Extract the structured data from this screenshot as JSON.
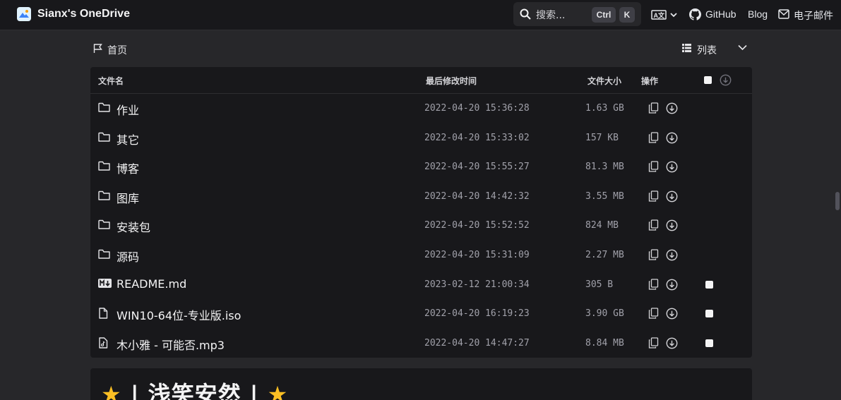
{
  "header": {
    "brand": "Sianx's OneDrive",
    "search_placeholder": "搜索...",
    "kbd_ctrl": "Ctrl",
    "kbd_k": "K",
    "github": "GitHub",
    "blog": "Blog",
    "email": "电子邮件"
  },
  "breadcrumb": {
    "home": "首页"
  },
  "view": {
    "label": "列表"
  },
  "table": {
    "columns": {
      "name": "文件名",
      "modified": "最后修改时间",
      "size": "文件大小",
      "actions": "操作"
    },
    "rows": [
      {
        "type": "folder",
        "name": "作业",
        "modified": "2022-04-20 15:36:28",
        "size": "1.63 GB"
      },
      {
        "type": "folder",
        "name": "其它",
        "modified": "2022-04-20 15:33:02",
        "size": "157 KB"
      },
      {
        "type": "folder",
        "name": "博客",
        "modified": "2022-04-20 15:55:27",
        "size": "81.3 MB"
      },
      {
        "type": "folder",
        "name": "图库",
        "modified": "2022-04-20 14:42:32",
        "size": "3.55 MB"
      },
      {
        "type": "folder",
        "name": "安装包",
        "modified": "2022-04-20 15:52:52",
        "size": "824 MB"
      },
      {
        "type": "folder",
        "name": "源码",
        "modified": "2022-04-20 15:31:09",
        "size": "2.27 MB"
      },
      {
        "type": "markdown",
        "name": "README.md",
        "modified": "2023-02-12 21:00:34",
        "size": "305 B"
      },
      {
        "type": "file",
        "name": "WIN10-64位-专业版.iso",
        "modified": "2022-04-20 16:19:23",
        "size": "3.90 GB"
      },
      {
        "type": "audio",
        "name": "木小雅 - 可能否.mp3",
        "modified": "2022-04-20 14:47:27",
        "size": "8.84 MB"
      }
    ]
  },
  "readme": {
    "star_left": "★",
    "title": "| 浅笑安然 |",
    "star_right": "★"
  },
  "colors": {
    "header_bg": "#18181b",
    "page_bg": "#27272a",
    "card_bg": "#18181b",
    "star": "#fbbf24"
  }
}
